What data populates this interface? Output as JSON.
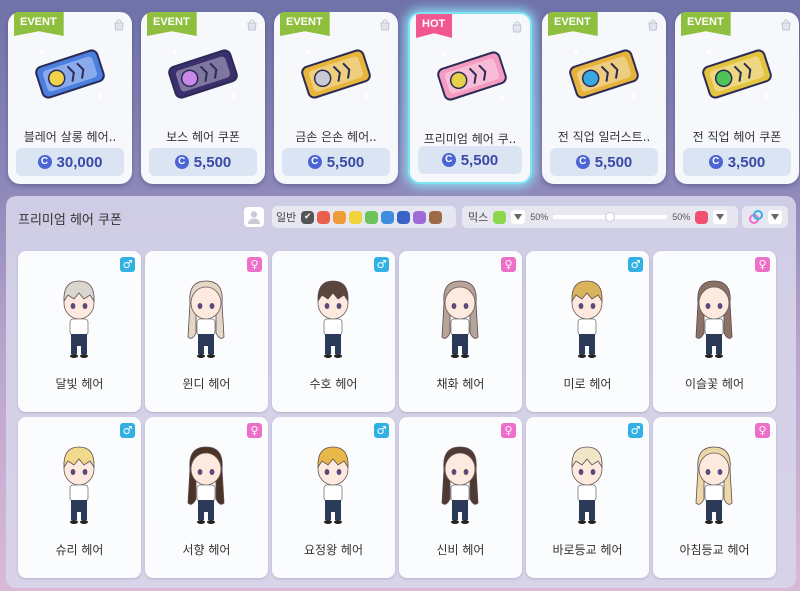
{
  "top_cards": [
    {
      "badge": "EVENT",
      "badge_type": "event",
      "name": "블레어 살롱 헤어..",
      "price": "30,000",
      "art_color": "#4a7fe0",
      "art_accent": "#f2d24a"
    },
    {
      "badge": "EVENT",
      "badge_type": "event",
      "name": "보스 헤어 쿠폰",
      "price": "5,500",
      "art_color": "#3b2f6e",
      "art_accent": "#c889e8"
    },
    {
      "badge": "EVENT",
      "badge_type": "event",
      "name": "금손 은손 헤어..",
      "price": "5,500",
      "art_color": "#e7b53a",
      "art_accent": "#c9c9d6"
    },
    {
      "badge": "HOT",
      "badge_type": "hot",
      "name": "프리미엄 헤어 쿠..",
      "price": "5,500",
      "art_color": "#f59ac0",
      "art_accent": "#e7d04a"
    },
    {
      "badge": "EVENT",
      "badge_type": "event",
      "name": "전 직업 일러스트..",
      "price": "5,500",
      "art_color": "#e5b23c",
      "art_accent": "#3aa8e0"
    },
    {
      "badge": "EVENT",
      "badge_type": "event",
      "name": "전 직업 헤어 쿠폰",
      "price": "3,500",
      "art_color": "#e3c43e",
      "art_accent": "#4fc25a"
    }
  ],
  "currency_symbol": "C",
  "panel": {
    "title": "프리미엄 헤어 쿠폰",
    "color_label": "일반",
    "colors": [
      "#555555",
      "#e8604e",
      "#f09a3a",
      "#f2d23a",
      "#6cc35a",
      "#3e8ee0",
      "#3a63c8",
      "#a06ad8",
      "#9c6a45"
    ],
    "mix_label": "믹스",
    "mix_color_1": "#8bd64a",
    "mix_color_2": "#f0506e",
    "mix_pct_left": "50%",
    "mix_pct_right": "50%",
    "mix_ratio": 0.5
  },
  "hairs": [
    {
      "name": "달빛 헤어",
      "gender": "male",
      "symbol": "♂",
      "hair_color": "#d9d6d0"
    },
    {
      "name": "윈디 헤어",
      "gender": "female",
      "symbol": "♀",
      "hair_color": "#e3d8c6"
    },
    {
      "name": "수호 헤어",
      "gender": "male",
      "symbol": "♂",
      "hair_color": "#5a463c"
    },
    {
      "name": "채화 헤어",
      "gender": "female",
      "symbol": "♀",
      "hair_color": "#b6a49a"
    },
    {
      "name": "미로 헤어",
      "gender": "male",
      "symbol": "♂",
      "hair_color": "#d9b45a"
    },
    {
      "name": "이슬꽃 헤어",
      "gender": "female",
      "symbol": "♀",
      "hair_color": "#8b7264"
    },
    {
      "name": "슈리 헤어",
      "gender": "male",
      "symbol": "♂",
      "hair_color": "#f0d98a"
    },
    {
      "name": "서향 헤어",
      "gender": "female",
      "symbol": "♀",
      "hair_color": "#4b3328"
    },
    {
      "name": "요정왕 헤어",
      "gender": "male",
      "symbol": "♂",
      "hair_color": "#e9b84a"
    },
    {
      "name": "신비 헤어",
      "gender": "female",
      "symbol": "♀",
      "hair_color": "#4e3a33"
    },
    {
      "name": "바로등교 헤어",
      "gender": "male",
      "symbol": "♂",
      "hair_color": "#f1e6c8"
    },
    {
      "name": "아침등교 헤어",
      "gender": "female",
      "symbol": "♀",
      "hair_color": "#ecd8a6"
    }
  ]
}
